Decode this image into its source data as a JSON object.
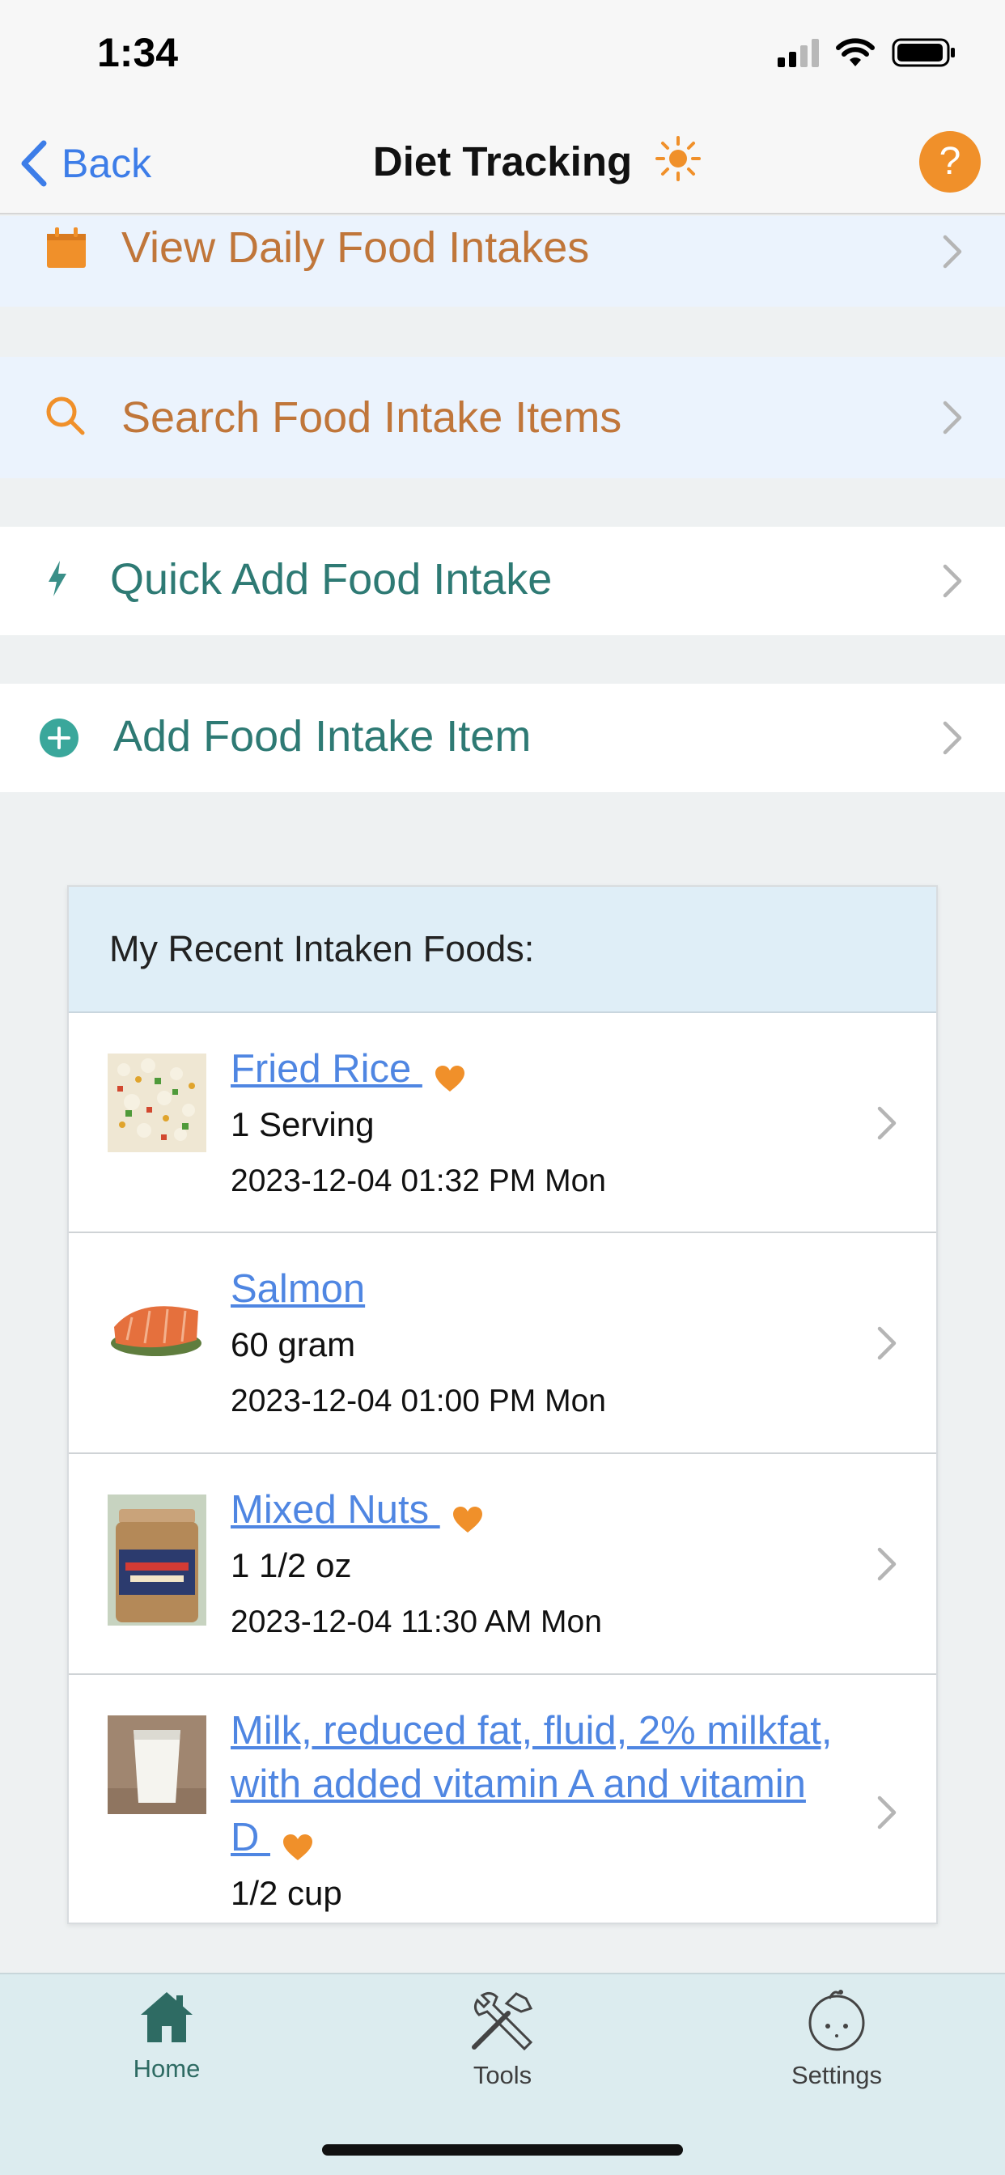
{
  "status_bar": {
    "time": "1:34"
  },
  "nav": {
    "back_label": "Back",
    "title": "Diet Tracking"
  },
  "menu": {
    "view_daily": "View Daily Food Intakes",
    "search": "Search Food Intake Items",
    "quick_add": "Quick Add Food Intake",
    "add_item": "Add Food Intake Item"
  },
  "recent": {
    "header": "My Recent Intaken Foods:",
    "items": [
      {
        "name": "Fried Rice ",
        "qty": "1 Serving",
        "time": "2023-12-04 01:32 PM Mon",
        "favorite": true
      },
      {
        "name": "Salmon",
        "qty": "60 gram",
        "time": "2023-12-04 01:00 PM Mon",
        "favorite": false
      },
      {
        "name": "Mixed Nuts ",
        "qty": "1 1/2 oz",
        "time": "2023-12-04 11:30 AM Mon",
        "favorite": true
      },
      {
        "name": "Milk, reduced fat, fluid, 2% milkfat, with added vitamin A and vitamin D ",
        "qty": "1/2 cup",
        "favorite": true
      }
    ]
  },
  "tabs": {
    "home": "Home",
    "tools": "Tools",
    "settings": "Settings"
  },
  "colors": {
    "accent_orange": "#f0902a",
    "link_blue": "#4f86e2",
    "teal": "#2e7a74",
    "menu_orange_text": "#c0763a"
  }
}
